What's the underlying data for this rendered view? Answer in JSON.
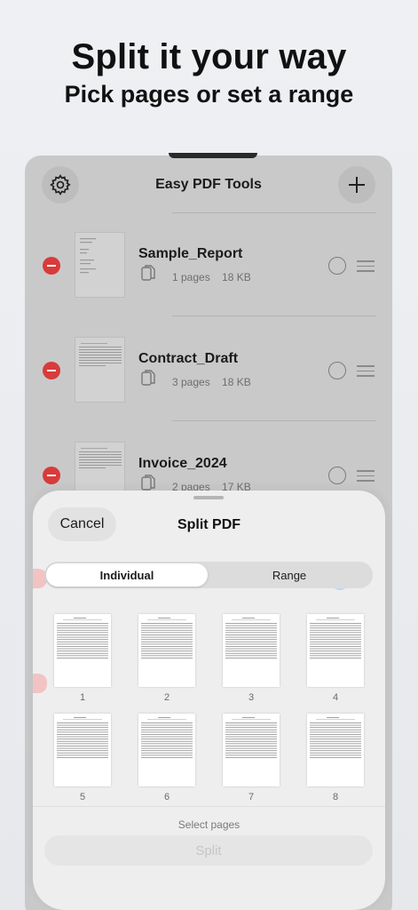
{
  "marketing": {
    "headline": "Split it your way",
    "subheadline": "Pick pages or set a range"
  },
  "app": {
    "title": "Easy PDF Tools",
    "settings_icon": "gear-icon",
    "add_icon": "plus-icon"
  },
  "files": [
    {
      "name": "Sample_Report",
      "pages": "1 pages",
      "size": "18 KB"
    },
    {
      "name": "Contract_Draft",
      "pages": "3 pages",
      "size": "18 KB"
    },
    {
      "name": "Invoice_2024",
      "pages": "2 pages",
      "size": "17 KB"
    }
  ],
  "split_sheet": {
    "cancel_label": "Cancel",
    "title": "Split PDF",
    "modes": [
      "Individual",
      "Range"
    ],
    "active_mode": "Individual",
    "pages": [
      "1",
      "2",
      "3",
      "4",
      "5",
      "6",
      "7",
      "8"
    ],
    "hint": "Select pages",
    "split_label": "Split"
  },
  "colors": {
    "remove_red": "#d83b3b",
    "sheet_bg": "#eeeeef",
    "dim_bg": "#c9c9ca"
  }
}
